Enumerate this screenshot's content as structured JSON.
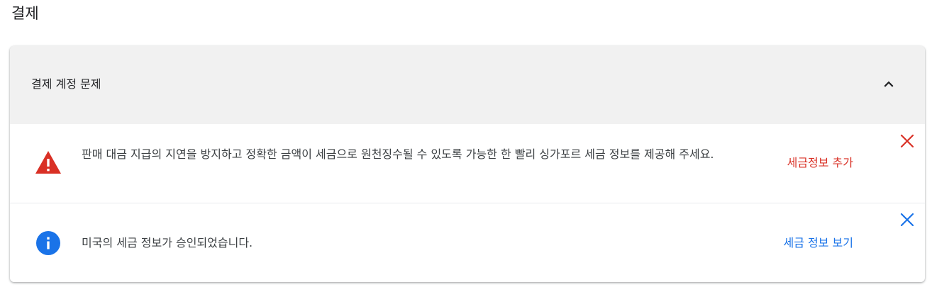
{
  "page": {
    "title": "결제"
  },
  "billing_issues": {
    "header_title": "결제 계정 문제",
    "collapse_icon": "chevron-up-icon",
    "alerts": [
      {
        "type": "warning",
        "icon": "warning-triangle-icon",
        "message": "판매 대금 지급의 지연을 방지하고 정확한 금액이 세금으로 원천징수될 수 있도록 가능한 한 빨리 싱가포르 세금 정보를 제공해 주세요.",
        "action_label": "세금정보 추가",
        "color": "#d93025",
        "dismiss_icon": "close-icon"
      },
      {
        "type": "info",
        "icon": "info-icon",
        "message": "미국의 세금 정보가 승인되었습니다.",
        "action_label": "세금 정보 보기",
        "color": "#1a73e8",
        "dismiss_icon": "close-icon"
      }
    ]
  },
  "colors": {
    "header_bg": "#f1f1f1",
    "warning": "#d93025",
    "info": "#1a73e8",
    "text": "#202124"
  }
}
